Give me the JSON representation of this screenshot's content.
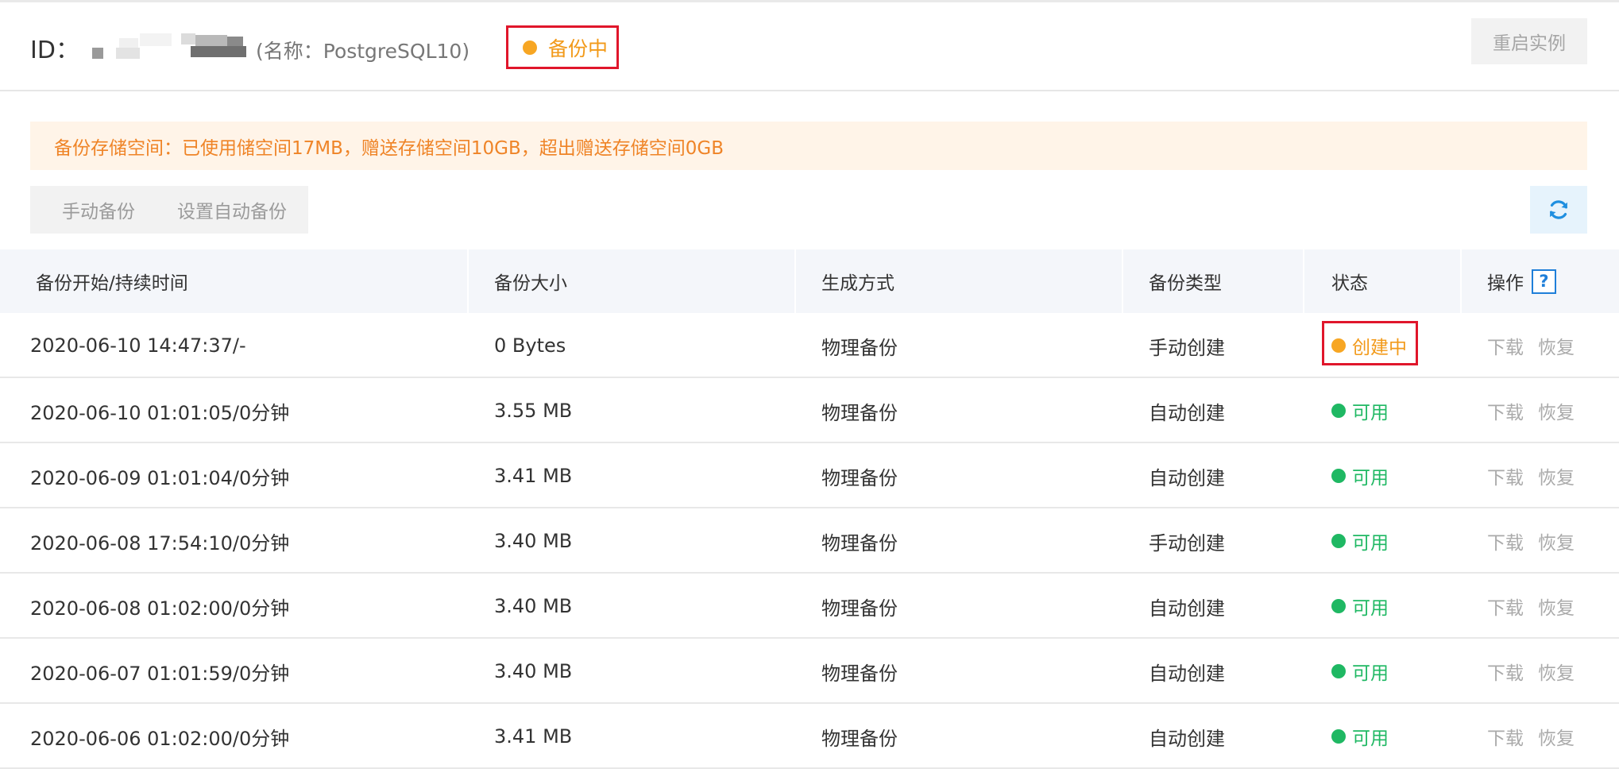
{
  "header": {
    "id_label": "ID：",
    "name_text": "(名称：PostgreSQL10)",
    "status_text": "备份中",
    "restart_button": "重启实例"
  },
  "notice": {
    "text": "备份存储空间：已使用储空间17MB，赠送存储空间10GB，超出赠送存储空间0GB"
  },
  "toolbar": {
    "manual_backup": "手动备份",
    "auto_backup_settings": "设置自动备份",
    "refresh_icon": "refresh-icon"
  },
  "table": {
    "headers": [
      "备份开始/持续时间",
      "备份大小",
      "生成方式",
      "备份类型",
      "状态",
      "操作"
    ],
    "help_icon_text": "?",
    "rows": [
      {
        "time": "2020-06-10 14:47:37/-",
        "size": "0 Bytes",
        "method": "物理备份",
        "type": "手动创建",
        "status": "创建中",
        "status_color": "#f29a1a",
        "download": "下载",
        "restore": "恢复"
      },
      {
        "time": "2020-06-10 01:01:05/0分钟",
        "size": "3.55 MB",
        "method": "物理备份",
        "type": "自动创建",
        "status": "可用",
        "status_color": "#1fb863",
        "download": "下载",
        "restore": "恢复"
      },
      {
        "time": "2020-06-09 01:01:04/0分钟",
        "size": "3.41 MB",
        "method": "物理备份",
        "type": "自动创建",
        "status": "可用",
        "status_color": "#1fb863",
        "download": "下载",
        "restore": "恢复"
      },
      {
        "time": "2020-06-08 17:54:10/0分钟",
        "size": "3.40 MB",
        "method": "物理备份",
        "type": "手动创建",
        "status": "可用",
        "status_color": "#1fb863",
        "download": "下载",
        "restore": "恢复"
      },
      {
        "time": "2020-06-08 01:02:00/0分钟",
        "size": "3.40 MB",
        "method": "物理备份",
        "type": "自动创建",
        "status": "可用",
        "status_color": "#1fb863",
        "download": "下载",
        "restore": "恢复"
      },
      {
        "time": "2020-06-07 01:01:59/0分钟",
        "size": "3.40 MB",
        "method": "物理备份",
        "type": "自动创建",
        "status": "可用",
        "status_color": "#1fb863",
        "download": "下载",
        "restore": "恢复"
      },
      {
        "time": "2020-06-06 01:02:00/0分钟",
        "size": "3.41 MB",
        "method": "物理备份",
        "type": "自动创建",
        "status": "可用",
        "status_color": "#1fb863",
        "download": "下载",
        "restore": "恢复"
      }
    ]
  },
  "colors": {
    "status_orange": "#f29a1a",
    "status_green": "#1fb863",
    "highlight_red": "#e0162b",
    "notice_bg": "#fff4e8",
    "notice_text": "#ef8427",
    "accent_blue": "#1f7fd9"
  }
}
